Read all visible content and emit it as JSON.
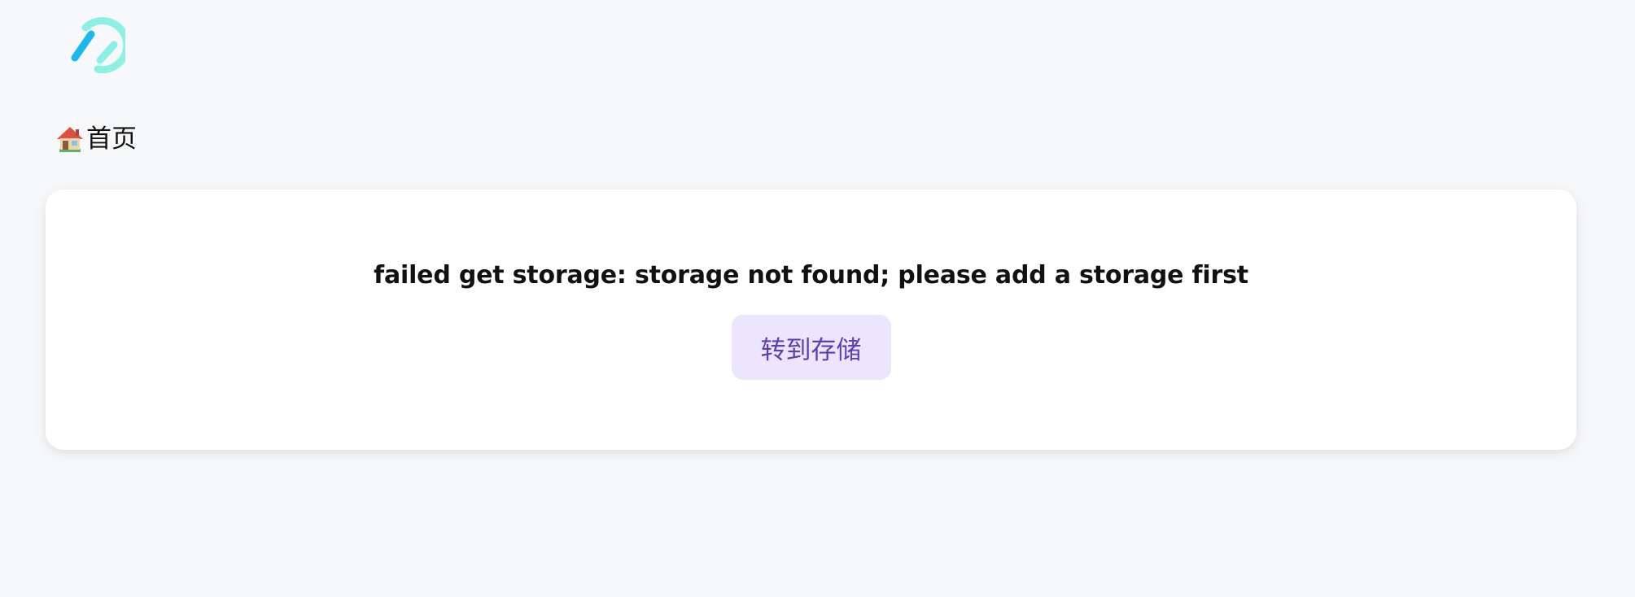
{
  "header": {
    "logo_icon": "app-logo-icon",
    "logo_colors": {
      "ring": "#8cf0e4",
      "bar": "#1ab8ef"
    }
  },
  "breadcrumb": {
    "home_icon": "house-emoji-icon",
    "label": "首页"
  },
  "main": {
    "error_message": "failed get storage: storage not found; please add a storage first",
    "goto_storage_label": "转到存储"
  },
  "colors": {
    "background": "#f7f8fa",
    "card": "#ffffff",
    "button_bg": "#ebe6fd",
    "button_fg": "#5b3fb3"
  }
}
